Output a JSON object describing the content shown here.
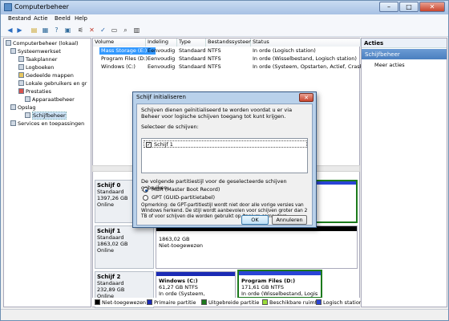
{
  "window": {
    "title": "Computerbeheer"
  },
  "menu": [
    "Bestand",
    "Actie",
    "Beeld",
    "Help"
  ],
  "tree": [
    {
      "label": "Computerbeheer (lokaal)",
      "level": 0
    },
    {
      "label": "Systeemwerkset",
      "level": 1
    },
    {
      "label": "Taakplanner",
      "level": 2
    },
    {
      "label": "Logboeken",
      "level": 2
    },
    {
      "label": "Gedeelde mappen",
      "level": 2
    },
    {
      "label": "Lokale gebruikers en gr",
      "level": 2
    },
    {
      "label": "Prestaties",
      "level": 2
    },
    {
      "label": "Apparaatbeheer",
      "level": 2
    },
    {
      "label": "Opslag",
      "level": 1
    },
    {
      "label": "Schijfbeheer",
      "level": 2
    },
    {
      "label": "Services en toepassingen",
      "level": 1
    }
  ],
  "volume_table": {
    "headers": [
      "Volume",
      "Indeling",
      "Type",
      "Bestandssysteem",
      "Status"
    ],
    "rows": [
      [
        "Mass Storage (E:)",
        "Eenvoudig",
        "Standaard",
        "NTFS",
        "In orde (Logisch station)"
      ],
      [
        "Program Files (D:)",
        "Eenvoudig",
        "Standaard",
        "NTFS",
        "In orde (Wisselbestand, Logisch station)"
      ],
      [
        "Windows (C:)",
        "Eenvoudig",
        "Standaard",
        "NTFS",
        "In orde (Systeem, Opstarten, Actief, Crashdu"
      ]
    ]
  },
  "disks": [
    {
      "name": "Schijf 0",
      "type": "Standaard",
      "size": "1397,26 GB",
      "state": "Online"
    },
    {
      "name": "Schijf 1",
      "type": "Standaard",
      "size": "1863,02 GB",
      "state": "Online"
    },
    {
      "name": "Schijf 2",
      "type": "Standaard",
      "size": "232,89 GB",
      "state": "Online"
    }
  ],
  "disk1_partition": {
    "size": "1863,02 GB",
    "status": "Niet-toegewezen"
  },
  "disk2_partitions": [
    {
      "name": "Windows (C:)",
      "size": "61,27 GB NTFS",
      "status": "In orde (Systeem, Opstarten, A"
    },
    {
      "name": "Program Files (D:)",
      "size": "171,61 GB NTFS",
      "status": "In orde (Wisselbestand, Logis"
    }
  ],
  "legend": [
    {
      "label": "Niet-toegewezen",
      "color": "#000000"
    },
    {
      "label": "Primaire partitie",
      "color": "#1b2bb5"
    },
    {
      "label": "Uitgebreide partitie",
      "color": "#1c7a1c"
    },
    {
      "label": "Beschikbare ruimte",
      "color": "#9bdd3a"
    },
    {
      "label": "Logisch station",
      "color": "#2a44d6"
    }
  ],
  "actions": {
    "header": "Acties",
    "section": "Schijfbeheer",
    "item": "Meer acties"
  },
  "dialog": {
    "title": "Schijf initialiseren",
    "intro": "Schijven dienen geïnitialiseerd te worden voordat u er via Beheer voor logische schijven toegang tot kunt krijgen.",
    "select_label": "Selecteer de schijven:",
    "disk_item": "Schijf 1",
    "disk_checked": true,
    "partition_style_label": "De volgende partitiestijl voor de geselecteerde schijven gebruiken:",
    "mbr_label": "MBR (Master Boot Record)",
    "gpt_label": "GPT (GUID-partitietabel)",
    "selected_style": "MBR",
    "note": "Opmerking: de GPT-partitiestijl wordt niet door alle vorige versies van Windows herkend. De stijl wordt aanbevolen voor schijven groter dan 2 TB of voor schijven die worden gebruikt op Itanium-computers.",
    "ok_label": "OK",
    "cancel_label": "Annuleren"
  }
}
